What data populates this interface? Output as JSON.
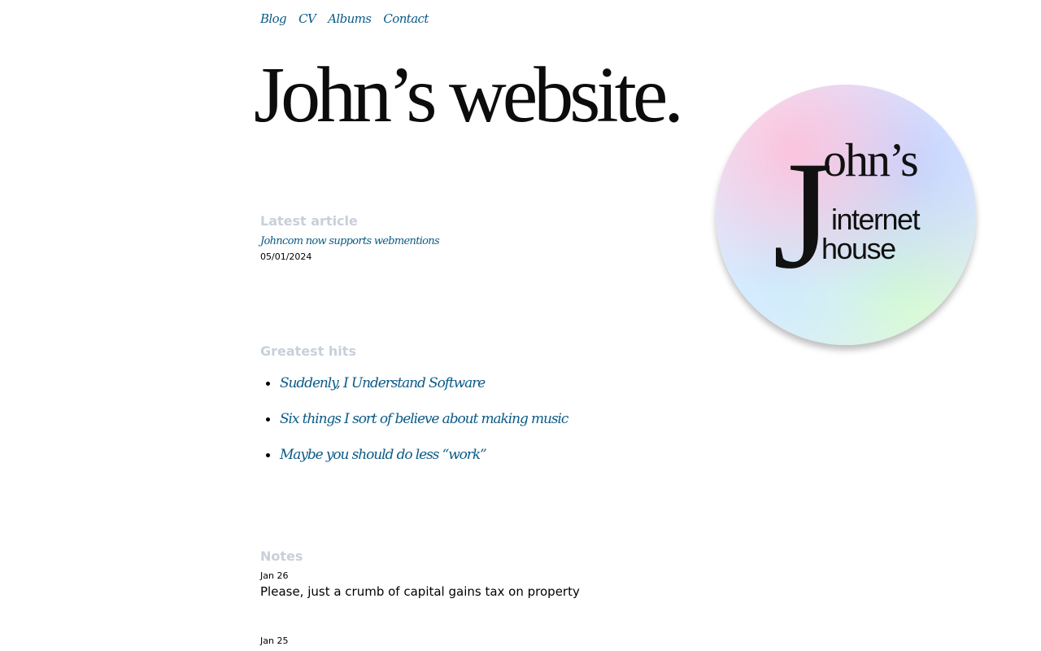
{
  "nav": {
    "items": [
      "Blog",
      "CV",
      "Albums",
      "Contact"
    ]
  },
  "site": {
    "title": "John’s website."
  },
  "logo": {
    "line1": "John’s",
    "line2": "internet",
    "line3": "house"
  },
  "latest_article": {
    "heading": "Latest article",
    "title": "Johncom now supports webmentions",
    "date": "05/01/2024"
  },
  "greatest_hits": {
    "heading": "Greatest hits",
    "items": [
      "Suddenly, I Understand Software",
      "Six things I sort of believe about making music",
      "Maybe you should do less “work”"
    ]
  },
  "notes": {
    "heading": "Notes",
    "items": [
      {
        "date": "Jan 26",
        "text": "Please, just a crumb of capital gains tax on property"
      },
      {
        "date": "Jan 25",
        "text": ""
      }
    ]
  },
  "colors": {
    "link": "#0b5a86",
    "heading_muted": "#c8d0da",
    "title": "#0c0c0c"
  }
}
